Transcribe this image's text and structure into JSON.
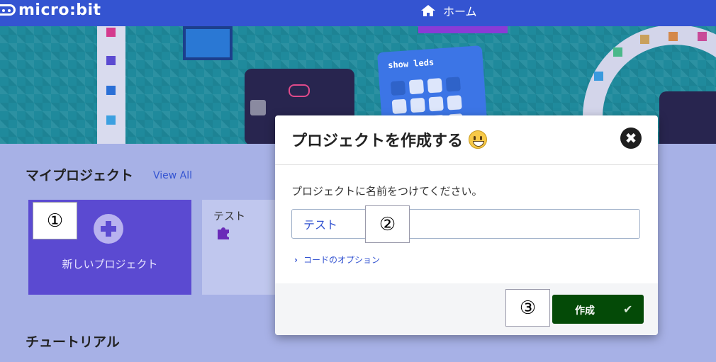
{
  "header": {
    "logo_text": "micro:bit",
    "home_label": "ホーム"
  },
  "banner": {
    "card_code_label": "show leds"
  },
  "my_projects": {
    "title": "マイプロジェクト",
    "view_all": "View All"
  },
  "new_project": {
    "label": "新しいプロジェクト"
  },
  "project_card": {
    "label": "テスト"
  },
  "tutorials": {
    "title": "チュートリアル"
  },
  "markers": {
    "m1": "①",
    "m2": "②",
    "m3": "③"
  },
  "dialog": {
    "title": "プロジェクトを作成する",
    "prompt": "プロジェクトに名前をつけてください。",
    "name_value": "テスト",
    "code_options": "コードのオプション",
    "create_label": "作成",
    "close_glyph": "✖",
    "check_glyph": "✔"
  },
  "colors": {
    "accent": "#3454d1",
    "create_button": "#044a07",
    "new_project_tile": "#5b4ad1"
  }
}
